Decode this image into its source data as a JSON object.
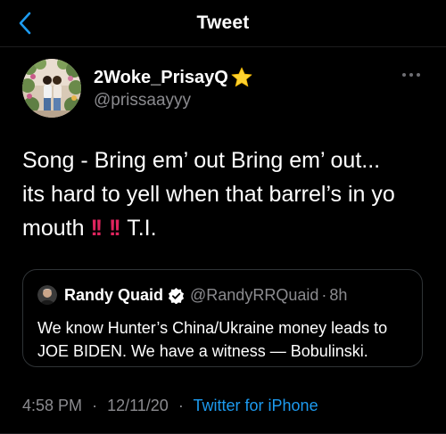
{
  "header": {
    "title": "Tweet",
    "back_icon": "chevron-left-icon",
    "accent_color": "#1d9bf0"
  },
  "author": {
    "display_name": "2Woke_PrisayQ",
    "badge_icon": "star-emoji-icon",
    "handle": "@prissaayyy",
    "more_icon": "more-horizontal-icon"
  },
  "tweet": {
    "text_line1": "Song - Bring em’ out Bring em’ out...",
    "text_line2": "its hard to yell when that barrel’s in yo",
    "text_line3_start": "mouth",
    "bang1": "!!",
    "bang2": "!!",
    "text_line3_end": "T.I."
  },
  "quote": {
    "name": "Randy Quaid",
    "verified_icon": "verified-badge-icon",
    "handle": "@RandyRRQuaid",
    "dot": "·",
    "time": "8h",
    "body": "We know Hunter’s China/Ukraine money leads to JOE BIDEN. We have a witness — Bobulinski."
  },
  "meta": {
    "time": "4:58 PM",
    "sep1": "·",
    "date": "12/11/20",
    "sep2": "·",
    "source": "Twitter for iPhone"
  },
  "colors": {
    "background": "#000000",
    "secondary_text": "#8b8b8f",
    "link": "#1d9bf0",
    "emphasis_red": "#e0245e",
    "border": "#2f3336"
  }
}
